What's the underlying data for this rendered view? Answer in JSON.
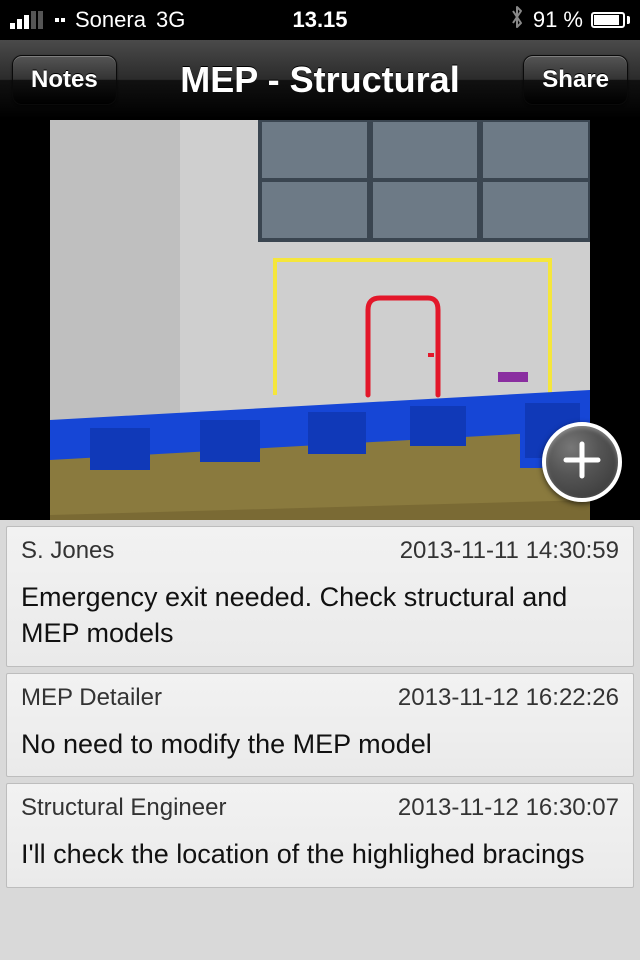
{
  "status": {
    "carrier": "Sonera",
    "network": "3G",
    "time": "13.15",
    "battery_pct": "91 %"
  },
  "nav": {
    "back_label": "Notes",
    "title": "MEP - Structural",
    "share_label": "Share"
  },
  "comments": [
    {
      "author": "S. Jones",
      "time": "2013-11-11 14:30:59",
      "body": "Emergency exit needed. Check structural and MEP models"
    },
    {
      "author": "MEP Detailer",
      "time": "2013-11-12 16:22:26",
      "body": "No need to modify the MEP model"
    },
    {
      "author": "Structural Engineer",
      "time": "2013-11-12 16:30:07",
      "body": "I'll check the location of the highlighed bracings"
    }
  ]
}
